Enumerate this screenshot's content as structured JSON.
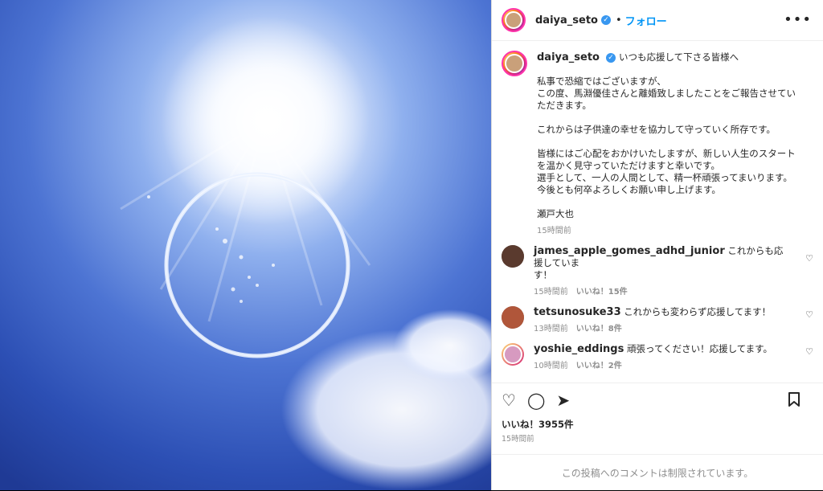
{
  "post_author": {
    "username": "daiya_seto",
    "follow_label": "フォロー",
    "separator": "•",
    "more_icon": "more-horizontal-icon"
  },
  "caption": {
    "username": "daiya_seto",
    "title": "いつも応援して下さる皆様へ",
    "body": "私事で恐縮ではございますが、\nこの度、馬淵優佳さんと離婚致しましたことをご報告させてい\nただきます。\n\nこれからは子供達の幸せを協力して守っていく所存です。\n\n皆様にはご心配をおかけいたしますが、新しい人生のスタート\nを温かく見守っていただけますと幸いです。\n選手として、一人の人間として、精一杯頑張ってまいります。\n今後とも何卒よろしくお願い申し上げます。\n\n瀬戸大也",
    "time": "15時間前"
  },
  "comments": [
    {
      "username": "james_apple_gomes_adhd_junior",
      "text": "これからも応援していま\nす！",
      "time": "15時間前",
      "likes": "いいね！15件",
      "avatar_color": "#5a3a2e"
    },
    {
      "username": "tetsunosuke33",
      "text": "これからも変わらず応援してます！",
      "time": "13時間前",
      "likes": "いいね！8件",
      "avatar_color": "#b0563a"
    },
    {
      "username": "yoshie_eddings",
      "text": "頑張ってください！応援してます。",
      "time": "10時間前",
      "likes": "いいね！2件",
      "avatar_color": "#d79ac0"
    }
  ],
  "actions": {
    "like_icon": "heart-icon",
    "comment_icon": "comment-icon",
    "share_icon": "share-icon",
    "save_icon": "bookmark-icon"
  },
  "likes_summary": "いいね！3955件",
  "post_time": "15時間前",
  "comments_restricted": "この投稿へのコメントは制限されています。",
  "colors": {
    "accent": "#0095f6",
    "verified": "#3897f0",
    "ocean": "#3a62c4"
  }
}
